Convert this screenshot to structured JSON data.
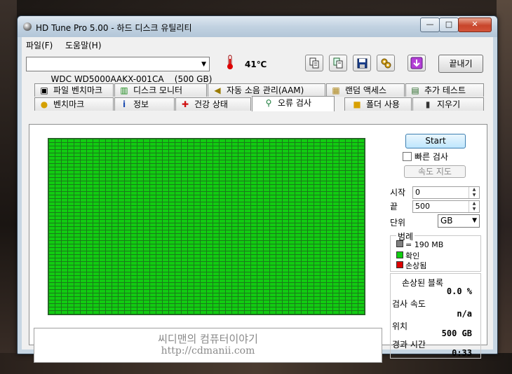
{
  "window": {
    "title": "HD Tune Pro 5.00 - 하드 디스크 유틸리티",
    "min_glyph": "—",
    "max_glyph": "□",
    "close_glyph": "✕"
  },
  "menu": [
    "파일(F)",
    "도움말(H)"
  ],
  "toolbar": {
    "drive": "WDC WD5000AAKX-001CA    (500 GB)",
    "temperature": "41℃",
    "exit_label": "끝내기",
    "icons": [
      "thermometer-icon",
      "copy-icon",
      "copy-all-icon",
      "save-icon",
      "options-icon",
      "download-icon"
    ]
  },
  "tabs_row1": [
    {
      "label": "파일 벤치마크",
      "icon": "file-benchmark-icon"
    },
    {
      "label": "디스크 모니터",
      "icon": "disk-monitor-icon"
    },
    {
      "label": "자동 소음 관리(AAM)",
      "icon": "speaker-icon"
    },
    {
      "label": "랜덤 액세스",
      "icon": "random-access-icon"
    },
    {
      "label": "추가 테스트",
      "icon": "extra-tests-icon"
    }
  ],
  "tabs_row2": [
    {
      "label": "벤치마크",
      "icon": "lightbulb-icon"
    },
    {
      "label": "정보",
      "icon": "info-icon"
    },
    {
      "label": "건강 상태",
      "icon": "health-cross-icon"
    },
    {
      "label": "오류 검사",
      "icon": "magnifier-icon",
      "active": true
    },
    {
      "label": "폴더 사용",
      "icon": "folder-icon"
    },
    {
      "label": "지우기",
      "icon": "trash-icon"
    }
  ],
  "error_scan": {
    "block_color": "#11cc11",
    "grid_line_color": "#1a7a1a",
    "watermark_line1": "씨디맨의 컴퓨터이야기",
    "watermark_line2": "http://cdmanii.com",
    "start_label": "Start",
    "quick_scan_label": "빠른 검사",
    "quick_scan_checked": false,
    "speed_map_label": "속도 지도",
    "start_field_label": "시작",
    "start_value": "0",
    "end_field_label": "끝",
    "end_value": "500",
    "unit_label": "단위",
    "unit_value": "GB",
    "legend": {
      "title": "범례",
      "items": [
        {
          "label": "= 190 MB",
          "color": "#808080"
        },
        {
          "label": "확인",
          "color": "#11cc11"
        },
        {
          "label": "손상됨",
          "color": "#dd0000"
        }
      ]
    },
    "stats": {
      "damaged_blocks_label": "손상된 블록",
      "damaged_blocks_value": "0.0 %",
      "scan_speed_label": "검사 속도",
      "scan_speed_value": "n/a",
      "position_label": "위치",
      "position_value": "500 GB",
      "elapsed_label": "경과 시간",
      "elapsed_value": "0:33"
    }
  }
}
